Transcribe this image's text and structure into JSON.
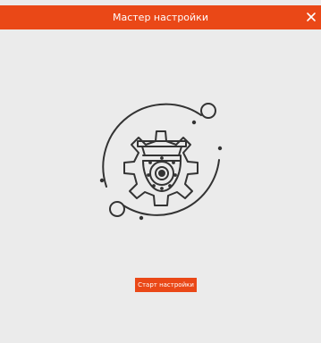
{
  "dialog": {
    "title": "Мастер настройки",
    "start_button": "Старт настройки"
  },
  "icons": {
    "close": "close-icon",
    "illustration": "camera-gear-icon"
  },
  "colors": {
    "accent": "#ea4817",
    "background": "#ebebeb",
    "line": "#333333"
  }
}
